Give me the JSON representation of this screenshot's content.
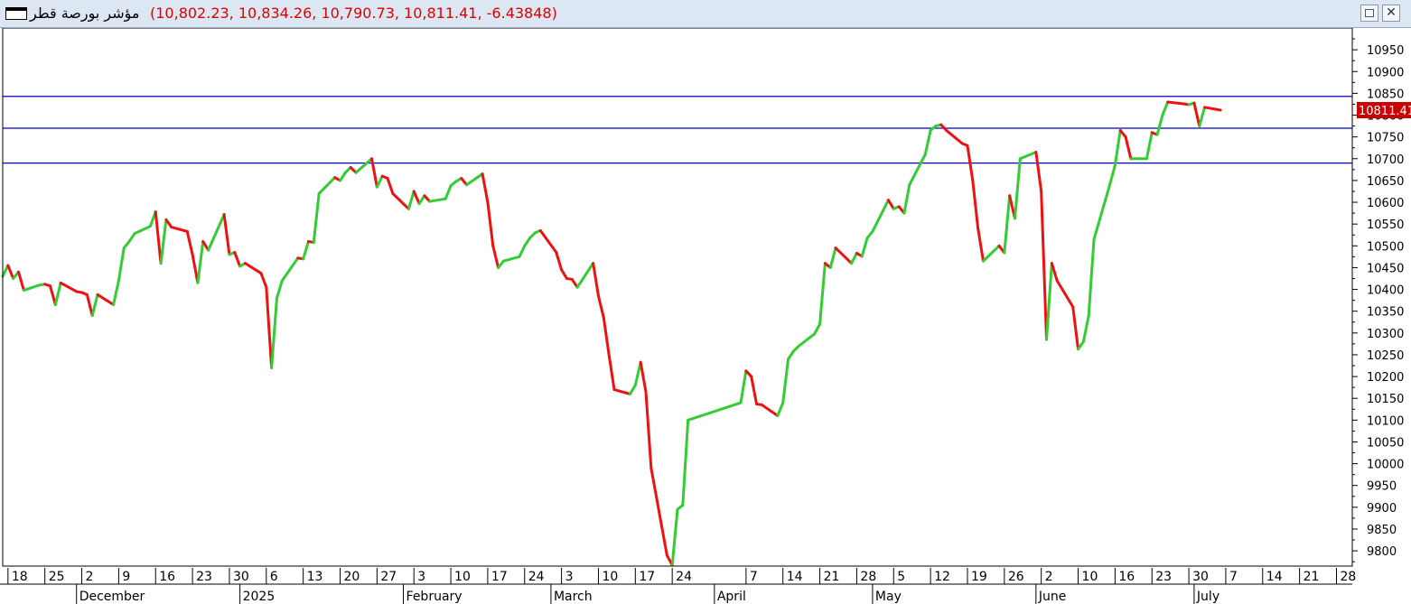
{
  "window": {
    "instrument": "مؤشر بورصة قطر",
    "ohlc_text": "(10,802.23, 10,834.26, 10,790.73, 10,811.41, -6.43848)",
    "restore_icon": "restore-icon",
    "close_icon": "close-icon",
    "close_glyph": "✕"
  },
  "chart_data": {
    "type": "line",
    "title": "",
    "xlabel": "",
    "ylabel": "",
    "ylim": [
      9765,
      11000
    ],
    "y_ticks": [
      9800,
      9850,
      9900,
      9950,
      10000,
      10050,
      10100,
      10150,
      10200,
      10250,
      10300,
      10350,
      10400,
      10450,
      10500,
      10550,
      10600,
      10650,
      10700,
      10750,
      10800,
      10850,
      10900,
      10950
    ],
    "last_value_label": "10811.41",
    "x_start": "2024-11-17",
    "x_end": "2025-07-31",
    "x_week_ticks": [
      {
        "date": "2024-11-18",
        "label": "18"
      },
      {
        "date": "2024-11-25",
        "label": "25"
      },
      {
        "date": "2024-12-02",
        "label": "2"
      },
      {
        "date": "2024-12-09",
        "label": "9"
      },
      {
        "date": "2024-12-16",
        "label": "16"
      },
      {
        "date": "2024-12-23",
        "label": "23"
      },
      {
        "date": "2024-12-30",
        "label": "30"
      },
      {
        "date": "2025-01-06",
        "label": "6"
      },
      {
        "date": "2025-01-13",
        "label": "13"
      },
      {
        "date": "2025-01-20",
        "label": "20"
      },
      {
        "date": "2025-01-27",
        "label": "27"
      },
      {
        "date": "2025-02-03",
        "label": "3"
      },
      {
        "date": "2025-02-10",
        "label": "10"
      },
      {
        "date": "2025-02-17",
        "label": "17"
      },
      {
        "date": "2025-02-24",
        "label": "24"
      },
      {
        "date": "2025-03-03",
        "label": "3"
      },
      {
        "date": "2025-03-10",
        "label": "10"
      },
      {
        "date": "2025-03-17",
        "label": "17"
      },
      {
        "date": "2025-03-24",
        "label": "24"
      },
      {
        "date": "2025-04-07",
        "label": "7"
      },
      {
        "date": "2025-04-14",
        "label": "14"
      },
      {
        "date": "2025-04-21",
        "label": "21"
      },
      {
        "date": "2025-04-28",
        "label": "28"
      },
      {
        "date": "2025-05-05",
        "label": "5"
      },
      {
        "date": "2025-05-12",
        "label": "12"
      },
      {
        "date": "2025-05-19",
        "label": "19"
      },
      {
        "date": "2025-05-26",
        "label": "26"
      },
      {
        "date": "2025-06-02",
        "label": "2"
      },
      {
        "date": "2025-06-09",
        "label": "10"
      },
      {
        "date": "2025-06-16",
        "label": "16"
      },
      {
        "date": "2025-06-23",
        "label": "23"
      },
      {
        "date": "2025-06-30",
        "label": "30"
      },
      {
        "date": "2025-07-07",
        "label": "7"
      },
      {
        "date": "2025-07-14",
        "label": "14"
      },
      {
        "date": "2025-07-21",
        "label": "21"
      },
      {
        "date": "2025-07-28",
        "label": "28"
      }
    ],
    "x_month_labels": [
      {
        "date": "2024-12-01",
        "label": "December"
      },
      {
        "date": "2025-01-01",
        "label": "2025"
      },
      {
        "date": "2025-02-01",
        "label": "February"
      },
      {
        "date": "2025-03-01",
        "label": "March"
      },
      {
        "date": "2025-04-01",
        "label": "April"
      },
      {
        "date": "2025-05-01",
        "label": "May"
      },
      {
        "date": "2025-06-01",
        "label": "June"
      },
      {
        "date": "2025-07-01",
        "label": "July"
      }
    ],
    "horizontal_lines": [
      10843,
      10770,
      10690
    ],
    "colors": {
      "up": "#33cc33",
      "down": "#ee1111",
      "hline": "#0000cc",
      "last_label_bg": "#cc0000",
      "last_label_text": "#ffffff"
    },
    "series": [
      {
        "points": [
          [
            "2024-11-17",
            10430
          ],
          [
            "2024-11-18",
            10455
          ],
          [
            "2024-11-19",
            10425
          ],
          [
            "2024-11-20",
            10440
          ],
          [
            "2024-11-21",
            10398
          ],
          [
            "2024-11-24",
            10410
          ],
          [
            "2024-11-25",
            10412
          ],
          [
            "2024-11-26",
            10408
          ],
          [
            "2024-11-27",
            10365
          ],
          [
            "2024-11-28",
            10415
          ],
          [
            "2024-12-01",
            10395
          ],
          [
            "2024-12-02",
            10393
          ],
          [
            "2024-12-03",
            10388
          ],
          [
            "2024-12-04",
            10340
          ],
          [
            "2024-12-05",
            10388
          ],
          [
            "2024-12-08",
            10365
          ],
          [
            "2024-12-09",
            10420
          ],
          [
            "2024-12-10",
            10495
          ],
          [
            "2024-12-11",
            10510
          ],
          [
            "2024-12-12",
            10528
          ],
          [
            "2024-12-15",
            10545
          ],
          [
            "2024-12-16",
            10578
          ],
          [
            "2024-12-17",
            10460
          ],
          [
            "2024-12-18",
            10560
          ],
          [
            "2024-12-19",
            10543
          ],
          [
            "2024-12-22",
            10533
          ],
          [
            "2024-12-23",
            10480
          ],
          [
            "2024-12-24",
            10415
          ],
          [
            "2024-12-25",
            10510
          ],
          [
            "2024-12-26",
            10490
          ],
          [
            "2024-12-29",
            10572
          ],
          [
            "2024-12-30",
            10480
          ],
          [
            "2024-12-31",
            10485
          ],
          [
            "2025-01-01",
            10453
          ],
          [
            "2025-01-02",
            10460
          ],
          [
            "2025-01-05",
            10437
          ],
          [
            "2025-01-06",
            10405
          ],
          [
            "2025-01-07",
            10220
          ],
          [
            "2025-01-08",
            10380
          ],
          [
            "2025-01-09",
            10420
          ],
          [
            "2025-01-12",
            10472
          ],
          [
            "2025-01-13",
            10470
          ],
          [
            "2025-01-14",
            10510
          ],
          [
            "2025-01-15",
            10508
          ],
          [
            "2025-01-16",
            10620
          ],
          [
            "2025-01-19",
            10657
          ],
          [
            "2025-01-20",
            10650
          ],
          [
            "2025-01-21",
            10668
          ],
          [
            "2025-01-22",
            10680
          ],
          [
            "2025-01-23",
            10668
          ],
          [
            "2025-01-26",
            10700
          ],
          [
            "2025-01-27",
            10635
          ],
          [
            "2025-01-28",
            10660
          ],
          [
            "2025-01-29",
            10655
          ],
          [
            "2025-01-30",
            10620
          ],
          [
            "2025-02-02",
            10585
          ],
          [
            "2025-02-03",
            10625
          ],
          [
            "2025-02-04",
            10597
          ],
          [
            "2025-02-05",
            10615
          ],
          [
            "2025-02-06",
            10602
          ],
          [
            "2025-02-09",
            10608
          ],
          [
            "2025-02-10",
            10638
          ],
          [
            "2025-02-11",
            10648
          ],
          [
            "2025-02-12",
            10655
          ],
          [
            "2025-02-13",
            10640
          ],
          [
            "2025-02-16",
            10665
          ],
          [
            "2025-02-17",
            10600
          ],
          [
            "2025-02-18",
            10500
          ],
          [
            "2025-02-19",
            10450
          ],
          [
            "2025-02-20",
            10465
          ],
          [
            "2025-02-23",
            10475
          ],
          [
            "2025-02-24",
            10500
          ],
          [
            "2025-02-25",
            10518
          ],
          [
            "2025-02-26",
            10530
          ],
          [
            "2025-02-27",
            10535
          ],
          [
            "2025-03-02",
            10485
          ],
          [
            "2025-03-03",
            10445
          ],
          [
            "2025-03-04",
            10425
          ],
          [
            "2025-03-05",
            10423
          ],
          [
            "2025-03-06",
            10405
          ],
          [
            "2025-03-09",
            10460
          ],
          [
            "2025-03-10",
            10385
          ],
          [
            "2025-03-11",
            10335
          ],
          [
            "2025-03-12",
            10250
          ],
          [
            "2025-03-13",
            10170
          ],
          [
            "2025-03-16",
            10160
          ],
          [
            "2025-03-17",
            10180
          ],
          [
            "2025-03-18",
            10233
          ],
          [
            "2025-03-19",
            10165
          ],
          [
            "2025-03-20",
            9990
          ],
          [
            "2025-03-23",
            9790
          ],
          [
            "2025-03-24",
            9767
          ],
          [
            "2025-03-25",
            9895
          ],
          [
            "2025-03-26",
            9905
          ],
          [
            "2025-03-27",
            10100
          ],
          [
            "2025-04-06",
            10140
          ],
          [
            "2025-04-07",
            10213
          ],
          [
            "2025-04-08",
            10200
          ],
          [
            "2025-04-09",
            10137
          ],
          [
            "2025-04-10",
            10135
          ],
          [
            "2025-04-13",
            10110
          ],
          [
            "2025-04-14",
            10140
          ],
          [
            "2025-04-15",
            10240
          ],
          [
            "2025-04-16",
            10258
          ],
          [
            "2025-04-17",
            10270
          ],
          [
            "2025-04-20",
            10298
          ],
          [
            "2025-04-21",
            10320
          ],
          [
            "2025-04-22",
            10460
          ],
          [
            "2025-04-23",
            10450
          ],
          [
            "2025-04-24",
            10495
          ],
          [
            "2025-04-27",
            10460
          ],
          [
            "2025-04-28",
            10483
          ],
          [
            "2025-04-29",
            10476
          ],
          [
            "2025-04-30",
            10518
          ],
          [
            "2025-05-01",
            10533
          ],
          [
            "2025-05-04",
            10605
          ],
          [
            "2025-05-05",
            10585
          ],
          [
            "2025-05-06",
            10590
          ],
          [
            "2025-05-07",
            10575
          ],
          [
            "2025-05-08",
            10640
          ],
          [
            "2025-05-11",
            10710
          ],
          [
            "2025-05-12",
            10765
          ],
          [
            "2025-05-13",
            10775
          ],
          [
            "2025-05-14",
            10778
          ],
          [
            "2025-05-15",
            10765
          ],
          [
            "2025-05-18",
            10735
          ],
          [
            "2025-05-19",
            10730
          ],
          [
            "2025-05-20",
            10650
          ],
          [
            "2025-05-21",
            10540
          ],
          [
            "2025-05-22",
            10465
          ],
          [
            "2025-05-25",
            10500
          ],
          [
            "2025-05-26",
            10484
          ],
          [
            "2025-05-27",
            10615
          ],
          [
            "2025-05-28",
            10563
          ],
          [
            "2025-05-29",
            10700
          ],
          [
            "2025-06-01",
            10715
          ],
          [
            "2025-06-02",
            10625
          ],
          [
            "2025-06-03",
            10285
          ],
          [
            "2025-06-04",
            10460
          ],
          [
            "2025-06-05",
            10420
          ],
          [
            "2025-06-08",
            10360
          ],
          [
            "2025-06-09",
            10263
          ],
          [
            "2025-06-10",
            10280
          ],
          [
            "2025-06-11",
            10340
          ],
          [
            "2025-06-12",
            10515
          ],
          [
            "2025-06-15",
            10640
          ],
          [
            "2025-06-16",
            10685
          ],
          [
            "2025-06-17",
            10765
          ],
          [
            "2025-06-18",
            10750
          ],
          [
            "2025-06-19",
            10700
          ],
          [
            "2025-06-22",
            10700
          ],
          [
            "2025-06-23",
            10760
          ],
          [
            "2025-06-24",
            10755
          ],
          [
            "2025-06-25",
            10800
          ],
          [
            "2025-06-26",
            10830
          ],
          [
            "2025-06-29",
            10826
          ],
          [
            "2025-06-30",
            10824
          ],
          [
            "2025-07-01",
            10828
          ],
          [
            "2025-07-02",
            10775
          ],
          [
            "2025-07-03",
            10818
          ],
          [
            "2025-07-06",
            10811.41
          ]
        ]
      }
    ]
  }
}
